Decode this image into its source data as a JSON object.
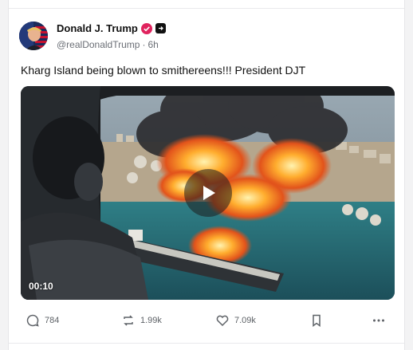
{
  "post": {
    "author_name": "Donald J. Trump",
    "handle": "@realDonaldTrump",
    "separator": "·",
    "time": "6h",
    "text": "Kharg Island being blown to smithereens!!! President DJT"
  },
  "media": {
    "duration": "00:10",
    "play_icon": "play-icon"
  },
  "actions": {
    "replies": "784",
    "reposts": "1.99k",
    "likes": "7.09k"
  },
  "colors": {
    "verified_badge": "#e0245e",
    "text_primary": "#111111",
    "text_secondary": "#6b6f76"
  }
}
